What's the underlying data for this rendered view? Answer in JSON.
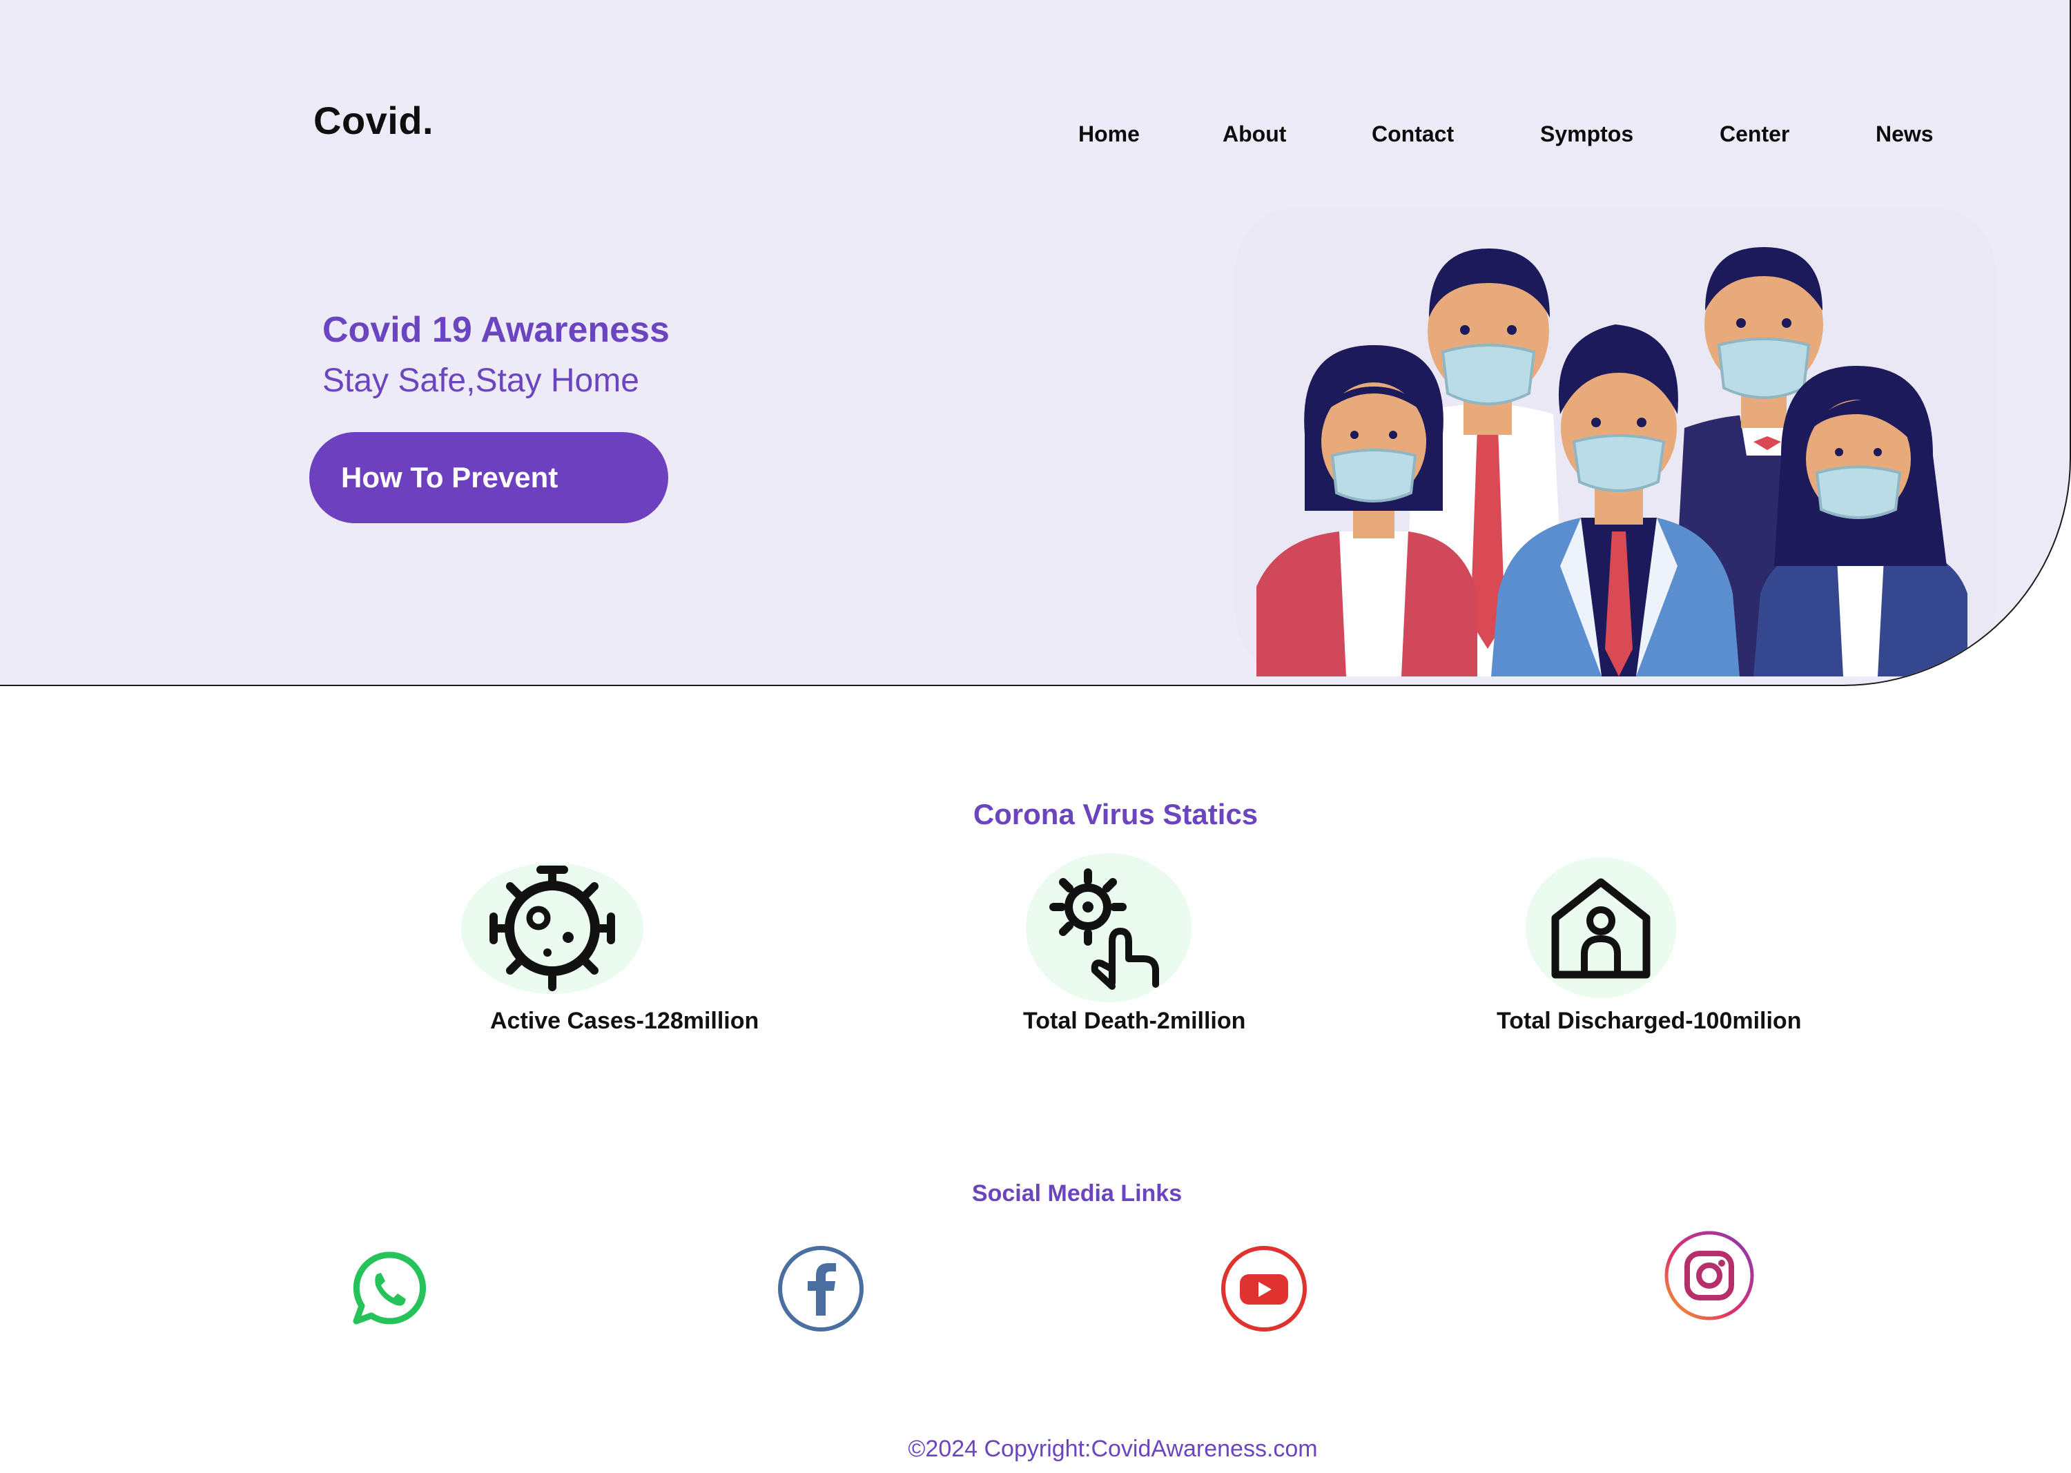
{
  "header": {
    "logo": "Covid.",
    "nav": [
      "Home",
      "About",
      "Contact",
      "Symptos",
      "Center",
      "News"
    ]
  },
  "hero": {
    "headline": "Covid 19 Awareness",
    "subline": "Stay Safe,Stay Home",
    "cta_label": "How To Prevent",
    "illustration_icon": "masked-people-illustration"
  },
  "stats": {
    "title": "Corona Virus Statics",
    "items": [
      {
        "icon": "virus-icon",
        "label": "Active Cases-128million"
      },
      {
        "icon": "touch-virus-icon",
        "label": "Total Death-2million"
      },
      {
        "icon": "home-person-icon",
        "label": "Total  Discharged-100milion"
      }
    ]
  },
  "social": {
    "title": "Social  Media Links",
    "icons": [
      "whatsapp-icon",
      "facebook-icon",
      "youtube-icon",
      "instagram-icon"
    ]
  },
  "footer": {
    "copyright": "©2024 Copyright:CovidAwareness.com"
  },
  "colors": {
    "accent": "#6b44bf",
    "hero_bg": "#eeebf8",
    "icon_bg": "#ecfbf0"
  }
}
